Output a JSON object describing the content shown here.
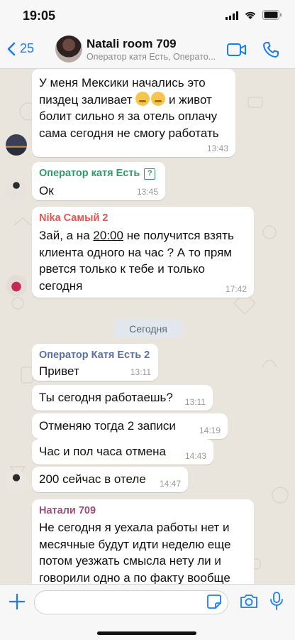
{
  "status_bar": {
    "time": "19:05"
  },
  "header": {
    "back_count": "25",
    "title": "Natali room 709",
    "subtitle": "Оператор катя Есть, Операто..."
  },
  "messages": [
    {
      "text": "У меня Мексики начались это\nпиздец заливает ",
      "text_b": " и живот\nболит сильно я за отель оплачу\nсама сегодня не смогу работать",
      "time": "13:43"
    },
    {
      "sender": "Оператор катя Есть",
      "sender_color": "#2d9c6a",
      "text": "Ок",
      "time": "13:45"
    },
    {
      "sender": "Nika Самый 2",
      "sender_color": "#e0554e",
      "text_a": "Зай, а на ",
      "text_u": "20:00",
      "text_b": " не получится взять\nклиента одного на час ? А то прям\nрвется только к тебе и только\nсегодня",
      "time": "17:42"
    },
    {
      "sender": "Оператор Катя Есть 2",
      "sender_color": "#5a6fa8",
      "text": "Привет",
      "time": "13:11"
    },
    {
      "text": "Ты сегодня работаешь?",
      "time": "13:11"
    },
    {
      "text": "Отменяю тогда 2 записи",
      "time": "14:19"
    },
    {
      "text": "Час и пол часа отмена",
      "time": "14:43"
    },
    {
      "text": "200 сейчас в отеле",
      "time": "14:47"
    },
    {
      "sender": "Натали 709",
      "sender_color": "#9b4f7a",
      "text": "Не сегодня я уехала работы нет и\nмесячные будут идти неделю еще\nпотом уезжать смысла нету ли и\nговорили одно а по факту вообще"
    }
  ],
  "date_separator": "Сегодня",
  "accent_color": "#1a7cf5",
  "icons": [
    "back-chevron-icon",
    "video-call-icon",
    "phone-icon",
    "plus-icon",
    "sticker-icon",
    "camera-icon",
    "microphone-icon"
  ]
}
